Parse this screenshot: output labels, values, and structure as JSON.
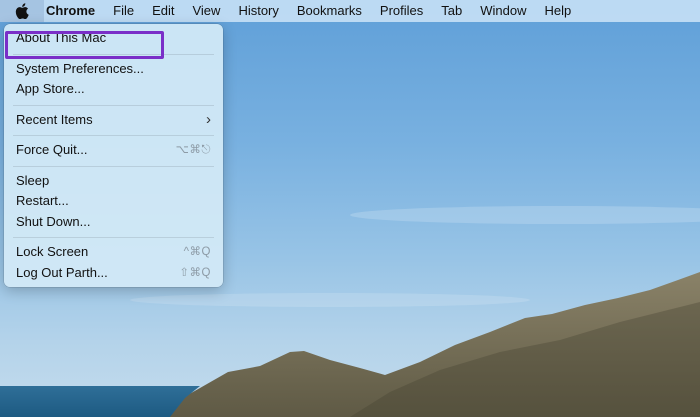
{
  "menubar": {
    "apple_icon": "apple-icon",
    "items": [
      "Chrome",
      "File",
      "Edit",
      "View",
      "History",
      "Bookmarks",
      "Profiles",
      "Tab",
      "Window",
      "Help"
    ]
  },
  "apple_menu": {
    "about": "About This Mac",
    "system_prefs": "System Preferences...",
    "app_store": "App Store...",
    "recent_items": "Recent Items",
    "force_quit": "Force Quit...",
    "force_quit_shortcut": "⌥⌘⎋",
    "sleep": "Sleep",
    "restart": "Restart...",
    "shut_down": "Shut Down...",
    "lock_screen": "Lock Screen",
    "lock_screen_shortcut": "^⌘Q",
    "log_out": "Log Out Parth...",
    "log_out_shortcut": "⇧⌘Q"
  },
  "colors": {
    "highlight_border": "#7a2fc8"
  }
}
